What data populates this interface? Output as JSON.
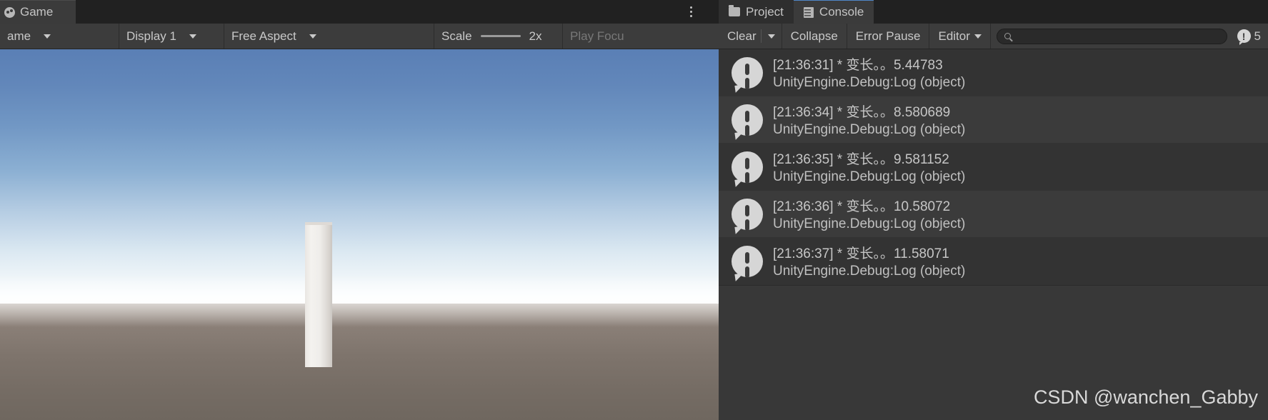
{
  "game_panel": {
    "tab": {
      "label": "Game",
      "icon": "game-view-icon"
    },
    "kebab_label": "more-options",
    "toolbar": {
      "left_dropdown_value": "ame",
      "display_value": "Display 1",
      "aspect_value": "Free Aspect",
      "scale_label": "Scale",
      "scale_value": "2x",
      "play_focused_label": "Play Focu"
    }
  },
  "console_panel": {
    "tabs": [
      {
        "label": "Project",
        "icon": "folder-icon",
        "active": false
      },
      {
        "label": "Console",
        "icon": "console-icon",
        "active": true
      }
    ],
    "toolbar": {
      "clear_label": "Clear",
      "collapse_label": "Collapse",
      "error_pause_label": "Error Pause",
      "editor_label": "Editor",
      "search_placeholder": "",
      "search_value": "",
      "search_icon": "search-icon",
      "info_count": "5",
      "info_badge_icon": "info-icon"
    },
    "logs": [
      {
        "message": "[21:36:31] * 变长。。5.44783",
        "stack": "UnityEngine.Debug:Log (object)",
        "type": "info"
      },
      {
        "message": "[21:36:34] * 变长。。8.580689",
        "stack": "UnityEngine.Debug:Log (object)",
        "type": "info"
      },
      {
        "message": "[21:36:35] * 变长。。9.581152",
        "stack": "UnityEngine.Debug:Log (object)",
        "type": "info"
      },
      {
        "message": "[21:36:36] * 变长。。10.58072",
        "stack": "UnityEngine.Debug:Log (object)",
        "type": "info"
      },
      {
        "message": "[21:36:37] * 变长。。11.58071",
        "stack": "UnityEngine.Debug:Log (object)",
        "type": "info"
      }
    ],
    "watermark": "CSDN @wanchen_Gabby"
  },
  "colors": {
    "panel_bg": "#383838",
    "toolbar_bg": "#3c3c3c",
    "tabbar_bg": "#212121",
    "active_tab_accent": "#4f86c6",
    "text": "#c9c9c9",
    "text_dim": "#787878"
  }
}
